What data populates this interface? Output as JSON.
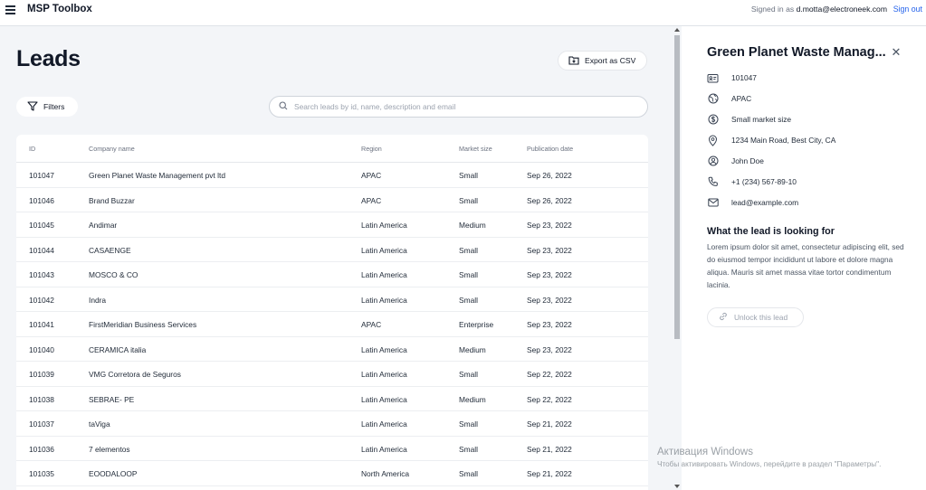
{
  "header": {
    "menu_icon": "hamburger-icon",
    "app_title": "MSP Toolbox",
    "signed_in_prefix": "Signed in as",
    "user_email": "d.motta@electroneek.com",
    "sign_out": "Sign out"
  },
  "main": {
    "title": "Leads",
    "export_label": "Export as CSV",
    "filters_label": "Filters",
    "search_placeholder": "Search leads by id, name, description and email",
    "search_value": ""
  },
  "table": {
    "columns": [
      "ID",
      "Company name",
      "Region",
      "Market size",
      "Publication date"
    ],
    "rows": [
      {
        "id": "101047",
        "name": "Green Planet Waste Management pvt ltd",
        "region": "APAC",
        "market": "Small",
        "date": "Sep 26, 2022"
      },
      {
        "id": "101046",
        "name": "Brand Buzzar",
        "region": "APAC",
        "market": "Small",
        "date": "Sep 26, 2022"
      },
      {
        "id": "101045",
        "name": "Andimar",
        "region": "Latin America",
        "market": "Medium",
        "date": "Sep 23, 2022"
      },
      {
        "id": "101044",
        "name": "CASAENGE",
        "region": "Latin America",
        "market": "Small",
        "date": "Sep 23, 2022"
      },
      {
        "id": "101043",
        "name": "MOSCO & CO",
        "region": "Latin America",
        "market": "Small",
        "date": "Sep 23, 2022"
      },
      {
        "id": "101042",
        "name": "Indra",
        "region": "Latin America",
        "market": "Small",
        "date": "Sep 23, 2022"
      },
      {
        "id": "101041",
        "name": "FirstMeridian Business Services",
        "region": "APAC",
        "market": "Enterprise",
        "date": "Sep 23, 2022"
      },
      {
        "id": "101040",
        "name": "CERAMICA italia",
        "region": "Latin America",
        "market": "Medium",
        "date": "Sep 23, 2022"
      },
      {
        "id": "101039",
        "name": "VMG Corretora de Seguros",
        "region": "Latin America",
        "market": "Small",
        "date": "Sep 22, 2022"
      },
      {
        "id": "101038",
        "name": "SEBRAE- PE",
        "region": "Latin America",
        "market": "Medium",
        "date": "Sep 22, 2022"
      },
      {
        "id": "101037",
        "name": "taViga",
        "region": "Latin America",
        "market": "Small",
        "date": "Sep 21, 2022"
      },
      {
        "id": "101036",
        "name": "7 elementos",
        "region": "Latin America",
        "market": "Small",
        "date": "Sep 21, 2022"
      },
      {
        "id": "101035",
        "name": "EOODALOOP",
        "region": "North America",
        "market": "Small",
        "date": "Sep 21, 2022"
      }
    ]
  },
  "detail": {
    "title": "Green Planet Waste Manag...",
    "close_icon": "close-icon",
    "id": "101047",
    "region": "APAC",
    "market_size": "Small market size",
    "address": "1234 Main Road, Best City, CA",
    "contact_name": "John Doe",
    "phone": "+1 (234) 567-89-10",
    "email": "lead@example.com",
    "looking_title": "What the lead is looking for",
    "looking_text": "Lorem ipsum dolor sit amet, consectetur adipiscing elit, sed do eiusmod tempor incididunt ut labore et dolore magna aliqua. Mauris sit amet massa vitae tortor condimentum lacinia.",
    "unlock_label": "Unlock this lead"
  },
  "watermark": {
    "title": "Активация Windows",
    "subtitle": "Чтобы активировать Windows, перейдите в раздел \"Параметры\"."
  },
  "colors": {
    "accent_link": "#2563eb",
    "background": "#f3f5f8",
    "surface": "#ffffff"
  }
}
